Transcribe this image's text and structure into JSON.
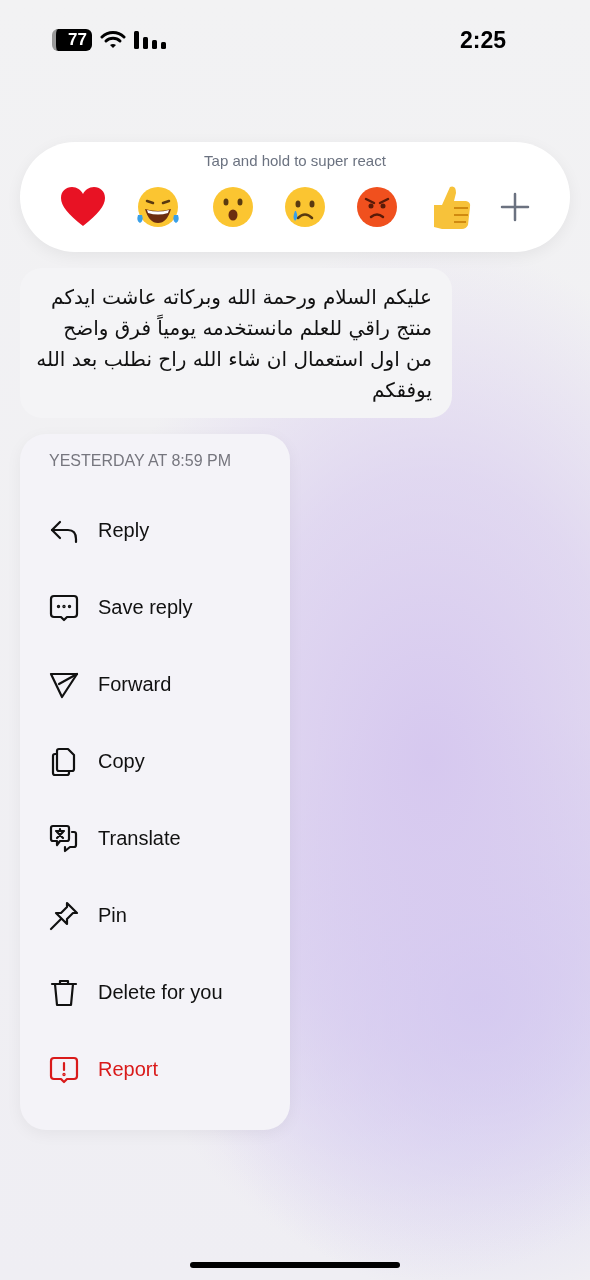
{
  "status_bar": {
    "battery": "77",
    "time": "2:25"
  },
  "reactions": {
    "hint": "Tap and hold to super react",
    "items": [
      {
        "kind": "heart"
      },
      {
        "kind": "laugh"
      },
      {
        "kind": "wow"
      },
      {
        "kind": "sad"
      },
      {
        "kind": "angry"
      },
      {
        "kind": "like"
      },
      {
        "kind": "add"
      }
    ]
  },
  "message": {
    "text": "عليكم السلام ورحمة الله وبركاته عاشت ايدكم منتج راقي للعلم مانستخدمه يومياً فرق واضح من اول استعمال ان شاء الله راح نطلب بعد الله يوفقكم"
  },
  "menu": {
    "timestamp": "YESTERDAY AT 8:59 PM",
    "items": [
      {
        "kind": "reply",
        "label": "Reply",
        "danger": false
      },
      {
        "kind": "save",
        "label": "Save reply",
        "danger": false
      },
      {
        "kind": "forward",
        "label": "Forward",
        "danger": false
      },
      {
        "kind": "copy",
        "label": "Copy",
        "danger": false
      },
      {
        "kind": "translate",
        "label": "Translate",
        "danger": false
      },
      {
        "kind": "pin",
        "label": "Pin",
        "danger": false
      },
      {
        "kind": "delete",
        "label": "Delete for you",
        "danger": false
      },
      {
        "kind": "report",
        "label": "Report",
        "danger": true
      }
    ]
  }
}
